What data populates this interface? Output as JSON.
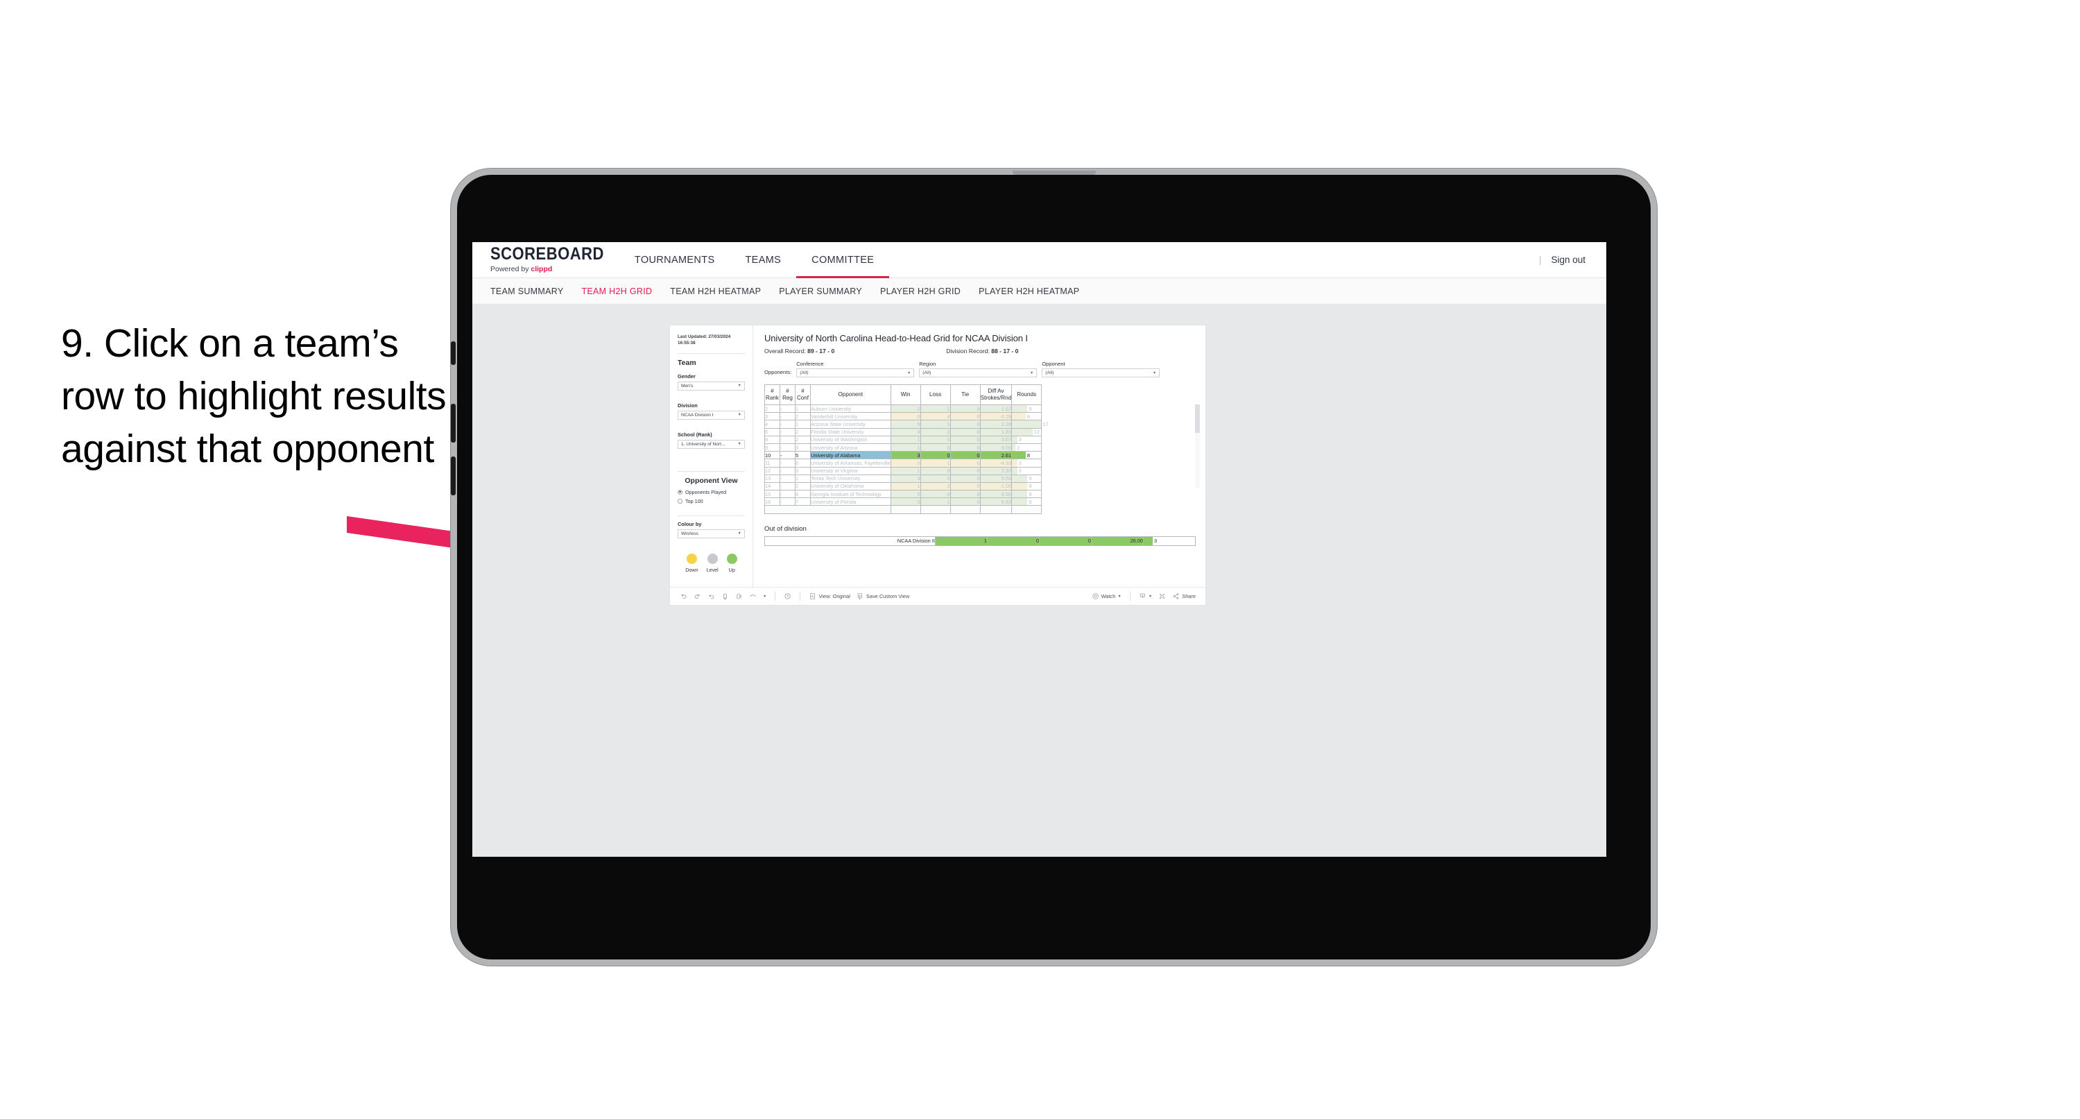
{
  "caption": "9. Click on a team’s row to highlight results against that opponent",
  "header": {
    "brand_name": "SCOREBOARD",
    "brand_sub_prefix": "Powered by ",
    "brand_sub_accent": "clippd",
    "nav": [
      {
        "label": "TOURNAMENTS",
        "active": false
      },
      {
        "label": "TEAMS",
        "active": false
      },
      {
        "label": "COMMITTEE",
        "active": true
      }
    ],
    "signout": "Sign out",
    "accent_color": "#e8174f"
  },
  "subtabs": [
    {
      "label": "TEAM SUMMARY",
      "active": false
    },
    {
      "label": "TEAM H2H GRID",
      "active": true
    },
    {
      "label": "TEAM H2H HEATMAP",
      "active": false
    },
    {
      "label": "PLAYER SUMMARY",
      "active": false
    },
    {
      "label": "PLAYER H2H GRID",
      "active": false
    },
    {
      "label": "PLAYER H2H HEATMAP",
      "active": false
    }
  ],
  "sidebar": {
    "last_updated": "Last Updated: 27/03/2024 16:55:38",
    "team_heading": "Team",
    "gender_label": "Gender",
    "gender_value": "Men’s",
    "division_label": "Division",
    "division_value": "NCAA Division I",
    "school_label": "School (Rank)",
    "school_value": "1. University of Nort...",
    "opponent_view_heading": "Opponent View",
    "opponent_view_options": [
      {
        "label": "Opponents Played",
        "selected": true
      },
      {
        "label": "Top 100",
        "selected": false
      }
    ],
    "colour_by_label": "Colour by",
    "colour_by_value": "Win/loss",
    "legend": [
      {
        "label": "Down",
        "color": "#f5d247"
      },
      {
        "label": "Level",
        "color": "#c6c9cd"
      },
      {
        "label": "Up",
        "color": "#8bc964"
      }
    ]
  },
  "main": {
    "title": "University of North Carolina Head-to-Head Grid for NCAA Division I",
    "overall_record_label": "Overall Record: ",
    "overall_record_value": "89 - 17 - 0",
    "division_record_label": "Division Record: ",
    "division_record_value": "88 - 17 - 0",
    "opponents_label": "Opponents:",
    "filters": [
      {
        "label": "Conference",
        "value": "(All)"
      },
      {
        "label": "Region",
        "value": "(All)"
      },
      {
        "label": "Opponent",
        "value": "(All)"
      }
    ],
    "out_of_division_heading": "Out of division"
  },
  "chart_data": {
    "type": "table",
    "title": "University of North Carolina Head-to-Head Grid for NCAA Division I",
    "columns": [
      "# Rank",
      "# Reg",
      "# Conf",
      "Opponent",
      "Win",
      "Loss",
      "Tie",
      "Diff Av Strokes/Rnd",
      "Rounds"
    ],
    "rounds_max": 17,
    "rows": [
      {
        "rank": "2",
        "reg": "-",
        "conf": "1",
        "opponent": "Auburn University",
        "win": "2",
        "loss": "1",
        "tie": "0",
        "diff": "1.67",
        "rounds": "9",
        "state": "win",
        "selected": false
      },
      {
        "rank": "3",
        "reg": "-",
        "conf": "2",
        "opponent": "Vanderbilt University",
        "win": "0",
        "loss": "4",
        "tie": "0",
        "diff": "-2.29",
        "rounds": "8",
        "state": "loss",
        "selected": false
      },
      {
        "rank": "4",
        "reg": "-",
        "conf": "1",
        "opponent": "Arizona State University",
        "win": "5",
        "loss": "1",
        "tie": "0",
        "diff": "2.28",
        "rounds": "17",
        "state": "win",
        "selected": false
      },
      {
        "rank": "6",
        "reg": "-",
        "conf": "2",
        "opponent": "Florida State University",
        "win": "4",
        "loss": "2",
        "tie": "0",
        "diff": "1.83",
        "rounds": "12",
        "state": "win",
        "selected": false
      },
      {
        "rank": "8",
        "reg": "-",
        "conf": "2",
        "opponent": "University of Washington",
        "win": "1",
        "loss": "0",
        "tie": "0",
        "diff": "3.67",
        "rounds": "3",
        "state": "win",
        "selected": false
      },
      {
        "rank": "9",
        "reg": "-",
        "conf": "3",
        "opponent": "University of Arizona",
        "win": "1",
        "loss": "0",
        "tie": "0",
        "diff": "9.00",
        "rounds": "2",
        "state": "win",
        "selected": false
      },
      {
        "rank": "10",
        "reg": "-",
        "conf": "5",
        "opponent": "University of Alabama",
        "win": "3",
        "loss": "0",
        "tie": "0",
        "diff": "2.61",
        "rounds": "8",
        "state": "win",
        "selected": true
      },
      {
        "rank": "11",
        "reg": "-",
        "conf": "6",
        "opponent": "University of Arkansas, Fayetteville",
        "win": "0",
        "loss": "1",
        "tie": "0",
        "diff": "-4.33",
        "rounds": "3",
        "state": "loss",
        "selected": false
      },
      {
        "rank": "12",
        "reg": "-",
        "conf": "3",
        "opponent": "University of Virginia",
        "win": "1",
        "loss": "0",
        "tie": "0",
        "diff": "2.33",
        "rounds": "3",
        "state": "win",
        "selected": false
      },
      {
        "rank": "13",
        "reg": "-",
        "conf": "1",
        "opponent": "Texas Tech University",
        "win": "3",
        "loss": "0",
        "tie": "0",
        "diff": "5.56",
        "rounds": "9",
        "state": "win",
        "selected": false
      },
      {
        "rank": "14",
        "reg": "-",
        "conf": "2",
        "opponent": "University of Oklahoma",
        "win": "1",
        "loss": "2",
        "tie": "0",
        "diff": "-1.00",
        "rounds": "9",
        "state": "loss",
        "selected": false
      },
      {
        "rank": "15",
        "reg": "-",
        "conf": "4",
        "opponent": "Georgia Institute of Technology",
        "win": "5",
        "loss": "0",
        "tie": "0",
        "diff": "4.50",
        "rounds": "9",
        "state": "win",
        "selected": false
      },
      {
        "rank": "16",
        "reg": "-",
        "conf": "7",
        "opponent": "University of Florida",
        "win": "3",
        "loss": "1",
        "tie": "0",
        "diff": "6.62",
        "rounds": "9",
        "state": "win",
        "selected": false
      }
    ],
    "out_of_division": {
      "label": "NCAA Division II",
      "win": "1",
      "loss": "0",
      "tie": "0",
      "diff": "26.00",
      "rounds": "3"
    }
  },
  "toolbar": {
    "view_label": "View: Original",
    "save_label": "Save Custom View",
    "watch_label": "Watch",
    "share_label": "Share"
  }
}
